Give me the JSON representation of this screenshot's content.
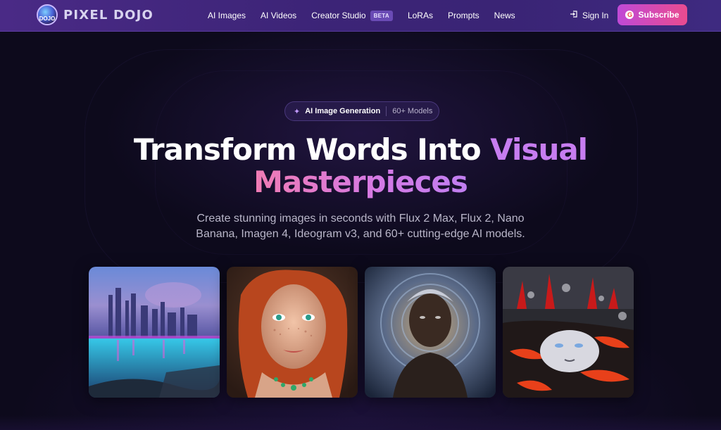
{
  "brand": {
    "name": "PIXEL DOJO",
    "badge_text": "DOJO"
  },
  "nav": {
    "links": [
      {
        "label": "AI Images"
      },
      {
        "label": "AI Videos"
      },
      {
        "label": "Creator Studio",
        "badge": "BETA"
      },
      {
        "label": "LoRAs"
      },
      {
        "label": "Prompts"
      },
      {
        "label": "News"
      }
    ],
    "sign_in": "Sign In",
    "subscribe": "Subscribe"
  },
  "hero": {
    "pill_primary": "AI Image Generation",
    "pill_secondary": "60+ Models",
    "headline_part1": "Transform Words Into ",
    "headline_accent": "Visual",
    "headline_line2": "Masterpieces",
    "subtext": "Create stunning images in seconds with Flux 2 Max, Flux 2, Nano Banana, Imagen 4, Ideogram v3, and 60+ cutting-edge AI models."
  },
  "gallery": {
    "images": [
      {
        "name": "futuristic-city-lake-image"
      },
      {
        "name": "red-haired-woman-portrait-image"
      },
      {
        "name": "woman-swirl-portrait-image"
      },
      {
        "name": "lava-head-sculpture-image"
      }
    ]
  },
  "colors": {
    "navbar_bg": "#3c2477",
    "page_bg": "#0d0a1c",
    "accent_purple": "#c77df0",
    "subscribe_gradient_start": "#c04ad6",
    "subscribe_gradient_end": "#ea4b8f"
  }
}
